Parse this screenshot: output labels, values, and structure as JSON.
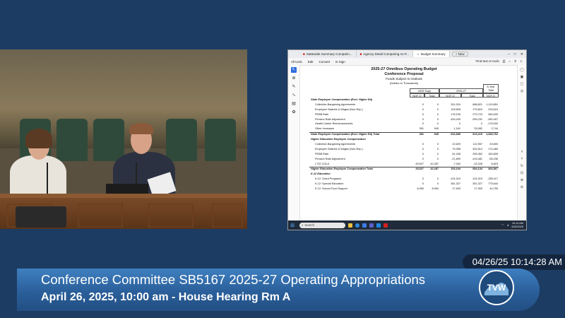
{
  "browser": {
    "tabs": [
      {
        "label": "Statewide Summary Comparin...",
        "icon": "pdf-icon"
      },
      {
        "label": "Agency Detail Comparing As P...",
        "icon": "pdf-icon"
      },
      {
        "label": "Budget Summary",
        "icon": "star-icon"
      }
    ],
    "new_tab_label": "+ New",
    "toolbar": [
      "All tools",
      "Edit",
      "Convert",
      "E-Sign"
    ],
    "find_label": "Find text or tools"
  },
  "document": {
    "title": "2025-27 Omnibus Operating Budget",
    "subtitle": "Conference Proposal",
    "funds_line": "Funds Subject to Outlook",
    "units": "(Dollars in Thousands)",
    "group_headers": {
      "supp": "2025 Supp",
      "biennium": "2025-27",
      "five_year": "5-Year Total"
    },
    "col_headers": [
      "NGF-O",
      "Total",
      "NGF-O",
      "Total",
      "NGF-O"
    ],
    "rows": [
      {
        "type": "sec",
        "label": "State Employee Compensation (Excl. Higher Ed)",
        "values": [
          "",
          "",
          "",
          "",
          ""
        ]
      },
      {
        "type": "item",
        "label": "Collective-Bargaining Agreements",
        "values": [
          "0",
          "0",
          "511,024",
          "688,821",
          "1,119,851"
        ]
      },
      {
        "type": "item",
        "label": "Employee Salaries & Wages (Non-Rep.)",
        "values": [
          "0",
          "0",
          "109,828",
          "175,824",
          "233,615"
        ]
      },
      {
        "type": "item",
        "label": "PEBB Rate",
        "values": [
          "0",
          "0",
          "178,105",
          "273,723",
          "383,009"
        ]
      },
      {
        "type": "item",
        "label": "Pension Rate Adjustment",
        "values": [
          "0",
          "0",
          "-163,429",
          "-259,231",
          "-280,457"
        ]
      },
      {
        "type": "item",
        "label": "Health Carrier Reimbursements",
        "values": [
          "0",
          "0",
          "0",
          "0",
          "-175,000"
        ]
      },
      {
        "type": "item",
        "label": "Other Increases",
        "values": [
          "351",
          "945",
          "1,161",
          "33,082",
          "2,744"
        ]
      },
      {
        "type": "tot",
        "label": "State Employee Compensation (Excl. Higher Ed) Total",
        "values": [
          "351",
          "945",
          "632,689",
          "913,219",
          "1,283,762"
        ]
      },
      {
        "type": "sec",
        "label": "Higher Education Employee Compensation",
        "values": [
          "",
          "",
          "",
          "",
          ""
        ]
      },
      {
        "type": "item",
        "label": "Collective-Bargaining Agreements",
        "values": [
          "0",
          "0",
          "22,609",
          "112,957",
          "49,800"
        ]
      },
      {
        "type": "item",
        "label": "Employee Salaries & Wages (Non-Rep.)",
        "values": [
          "0",
          "0",
          "79,398",
          "304,514",
          "174,480"
        ]
      },
      {
        "type": "item",
        "label": "PEBB Rate",
        "values": [
          "0",
          "0",
          "81,428",
          "255,362",
          "184,828"
        ]
      },
      {
        "type": "item",
        "label": "Pension Rate Adjustment",
        "values": [
          "0",
          "0",
          "-21,899",
          "-103,481",
          "-55,236"
        ]
      },
      {
        "type": "item",
        "label": "I-732 COLA",
        "values": [
          "28,527",
          "42,287",
          "-7,342",
          "-15,228",
          "8,815"
        ]
      },
      {
        "type": "tot",
        "label": "Higher Education Employee Compensation Total",
        "values": [
          "28,527",
          "42,287",
          "153,194",
          "554,134",
          "364,567"
        ]
      },
      {
        "type": "sec",
        "label": "K-12 Education",
        "values": [
          "",
          "",
          "",
          "",
          ""
        ]
      },
      {
        "type": "item",
        "label": "K-12: Grant Programs",
        "values": [
          "0",
          "0",
          "-131,019",
          "-131,019",
          "-269,117"
        ]
      },
      {
        "type": "item",
        "label": "K-12: Special Education",
        "values": [
          "0",
          "0",
          "351,327",
          "351,327",
          "775,644"
        ]
      },
      {
        "type": "item",
        "label": "K-12: School Food Support",
        "values": [
          "8,950",
          "8,950",
          "17,900",
          "17,900",
          "44,750"
        ]
      }
    ]
  },
  "taskbar": {
    "search_placeholder": "Search",
    "time": "10:14 AM",
    "date": "4/26/2025"
  },
  "broadcast": {
    "timestamp": "04/26/25 10:14:28 AM",
    "title": "Conference Committee SB5167 2025-27 Operating Appropriations",
    "subtitle": "April 26, 2025, 10:00 am - House Hearing Rm A",
    "logo_text": "TVW"
  },
  "colors": {
    "background": "#1c3c63",
    "lower_third": "#2a5f9a",
    "accent": "#2e6de0"
  }
}
